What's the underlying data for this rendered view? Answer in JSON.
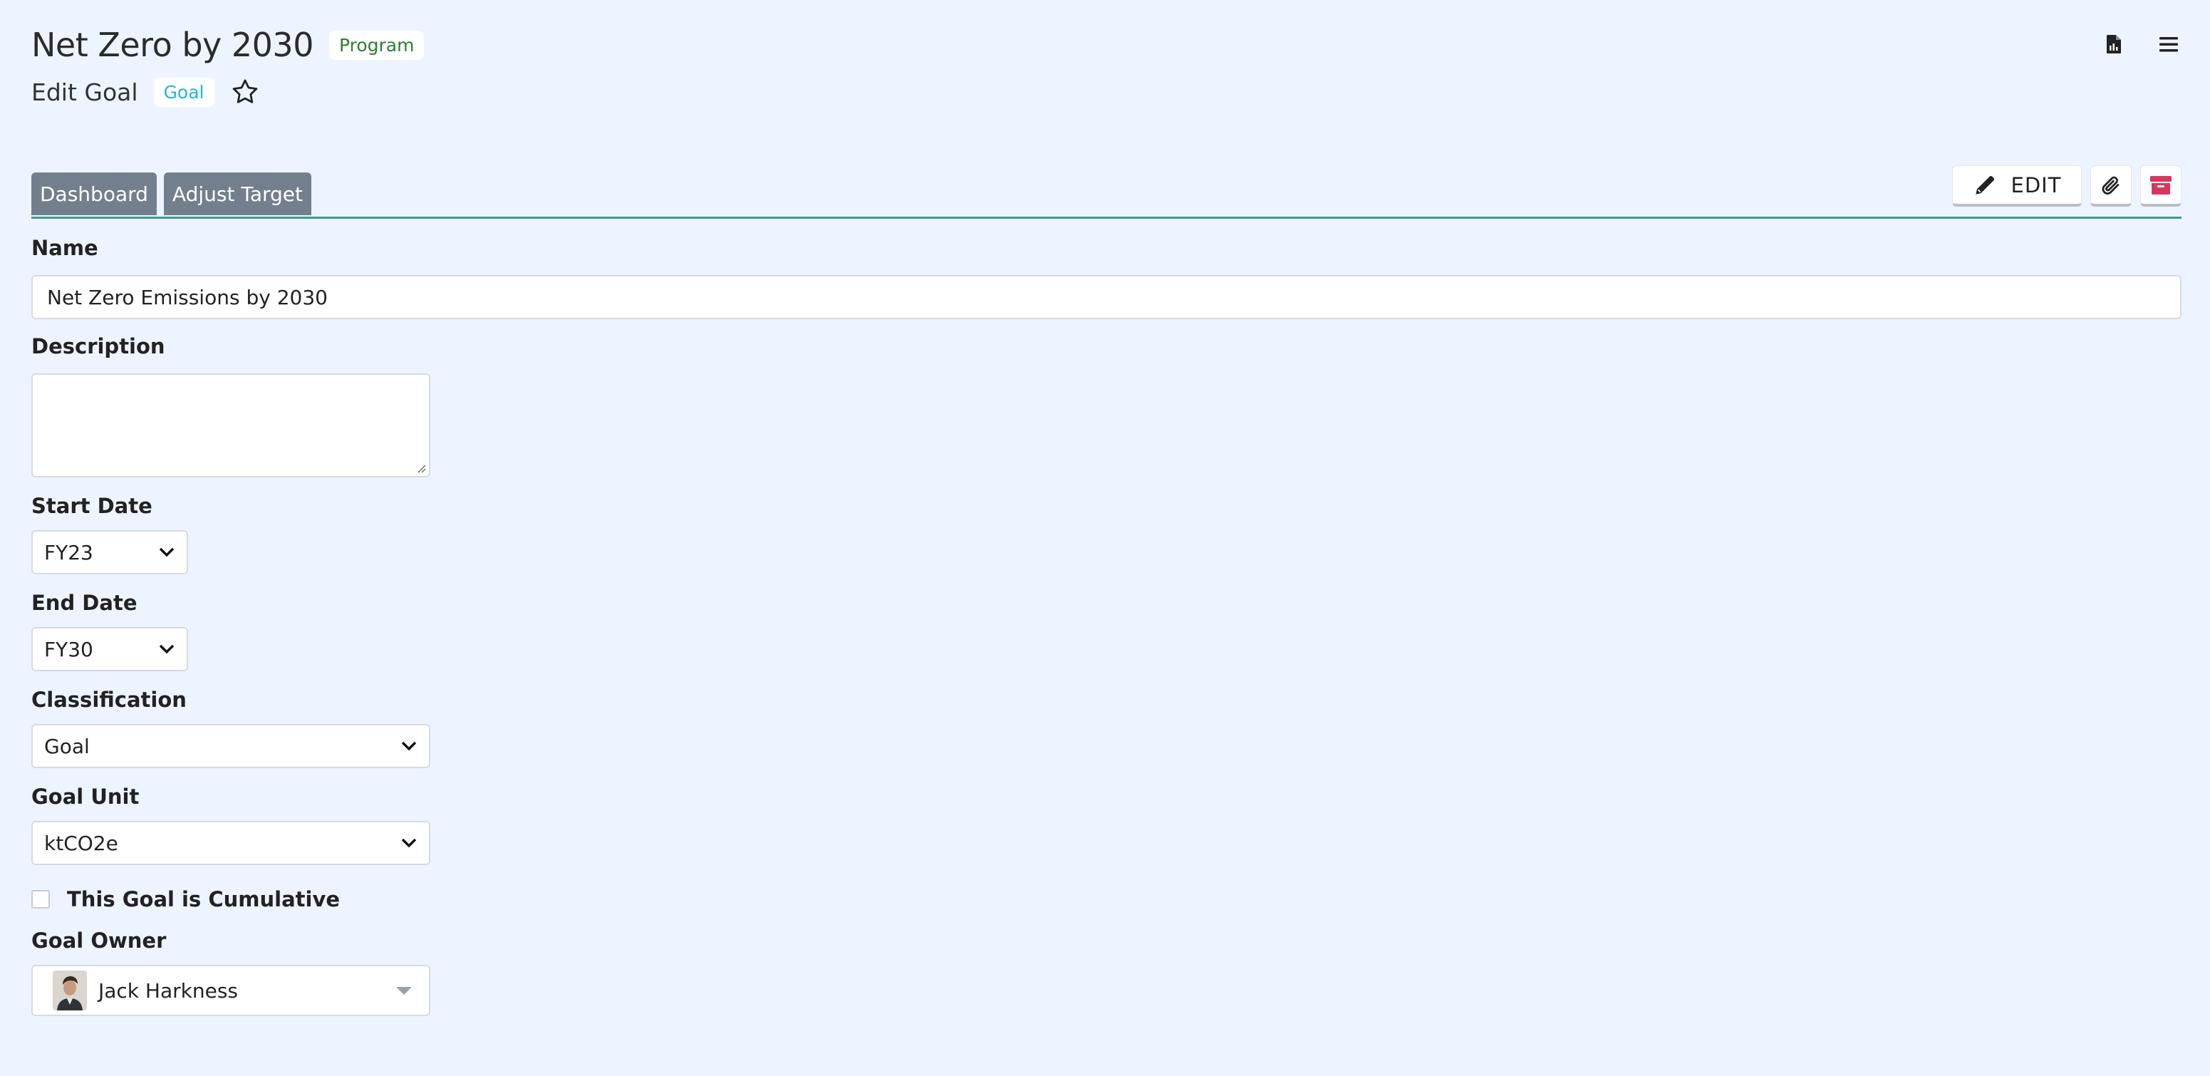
{
  "header": {
    "title": "Net Zero by 2030",
    "title_badge": "Program",
    "subtitle": "Edit Goal",
    "subtitle_badge": "Goal"
  },
  "tabs": [
    {
      "label": "Dashboard"
    },
    {
      "label": "Adjust Target"
    }
  ],
  "toolbar": {
    "edit_label": "EDIT"
  },
  "form": {
    "name": {
      "label": "Name",
      "value": "Net Zero Emissions by 2030"
    },
    "description": {
      "label": "Description",
      "value": ""
    },
    "start_date": {
      "label": "Start Date",
      "value": "FY23"
    },
    "end_date": {
      "label": "End Date",
      "value": "FY30"
    },
    "classification": {
      "label": "Classification",
      "value": "Goal"
    },
    "goal_unit": {
      "label": "Goal Unit",
      "value": "ktCO2e"
    },
    "cumulative": {
      "label": "This Goal is Cumulative",
      "checked": false
    },
    "goal_owner": {
      "label": "Goal Owner",
      "value": "Jack Harkness"
    }
  },
  "colors": {
    "background": "#eef4ff",
    "tab": "#737f8c",
    "tab_underline": "#3f9a8c",
    "program_badge": "#2e7d32",
    "goal_badge": "#22b7d2",
    "archive_icon": "#d9365e"
  }
}
